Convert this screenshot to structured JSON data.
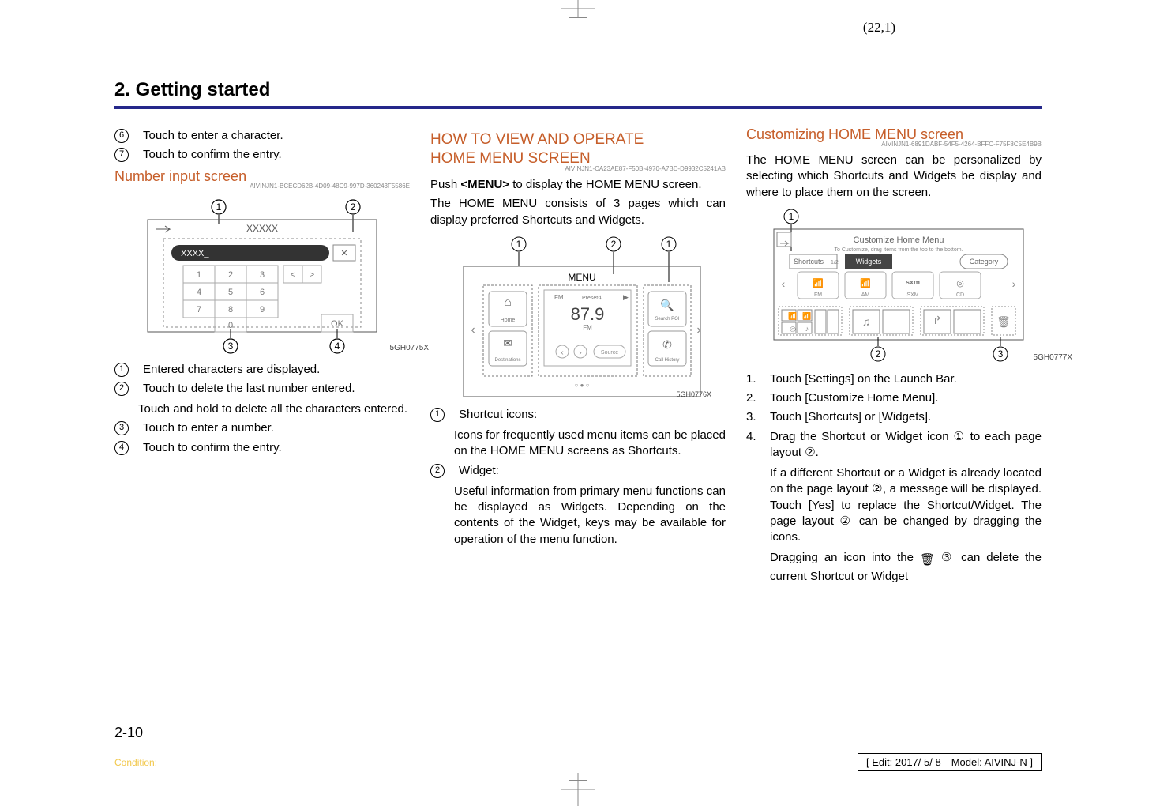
{
  "header": {
    "sheet": "(22,1)",
    "chapter": "2. Getting started"
  },
  "col1": {
    "bullets": [
      {
        "n": "6",
        "t": "Touch to enter a character."
      },
      {
        "n": "7",
        "t": "Touch to confirm the entry."
      }
    ],
    "section_title": "Number input screen",
    "guid": "AIVINJN1-BCECD62B-4D09-48C9-997D-360243F5586E",
    "figlabel": "5GH0775X",
    "items": [
      {
        "n": "1",
        "t": "Entered characters are displayed."
      },
      {
        "n": "2",
        "t": "Touch to delete the last number entered.",
        "sub": "Touch and hold to delete all the characters entered."
      },
      {
        "n": "3",
        "t": "Touch to enter a number."
      },
      {
        "n": "4",
        "t": "Touch to confirm the entry."
      }
    ]
  },
  "col2": {
    "title1": "HOW TO VIEW AND OPERATE",
    "title2": "HOME MENU SCREEN",
    "guid": "AIVINJN1-CA23AE87-F50B-4970-A7BD-D9932C5241AB",
    "p1a": "Push",
    "p1b": "<MENU>",
    "p1c": "to display the HOME MENU screen.",
    "p2": "The HOME MENU consists of 3 pages which can display preferred Shortcuts and Widgets.",
    "figlabel": "5GH0776X",
    "items": [
      {
        "n": "1",
        "t": "Shortcut icons:",
        "sub": "Icons for frequently used menu items can be placed on the HOME MENU screens as Shortcuts."
      },
      {
        "n": "2",
        "t": "Widget:",
        "sub": "Useful information from primary menu functions can be displayed as Widgets. Depending on the contents of the Widget, keys may be available for operation of the menu function."
      }
    ]
  },
  "col3": {
    "title": "Customizing HOME MENU screen",
    "guid": "AIVINJN1-6891DABF-54F5-4264-BFFC-F75F8C5E4B9B",
    "p1": "The HOME MENU screen can be personalized by selecting which Shortcuts and Widgets be display and where to place them on the screen.",
    "figlabel": "5GH0777X",
    "steps": [
      {
        "n": "1.",
        "t": "Touch [Settings] on the Launch Bar."
      },
      {
        "n": "2.",
        "t": "Touch [Customize Home Menu]."
      },
      {
        "n": "3.",
        "t": "Touch [Shortcuts] or [Widgets]."
      },
      {
        "n": "4.",
        "t": "Drag the Shortcut or Widget icon ① to each page layout ②.",
        "sub1": "If a different Shortcut or a Widget is already located on the page layout ②, a message will be displayed. Touch [Yes] to replace the Shortcut/Widget. The page layout ② can be changed by dragging the icons.",
        "sub2a": "Dragging an icon into the",
        "sub2b": "③ can delete the current Shortcut or Widget"
      }
    ]
  },
  "footer": {
    "page": "2-10",
    "condition": "Condition:",
    "edit": "[ Edit: 2017/ 5/ 8 Model: AIVINJ-N ]"
  }
}
